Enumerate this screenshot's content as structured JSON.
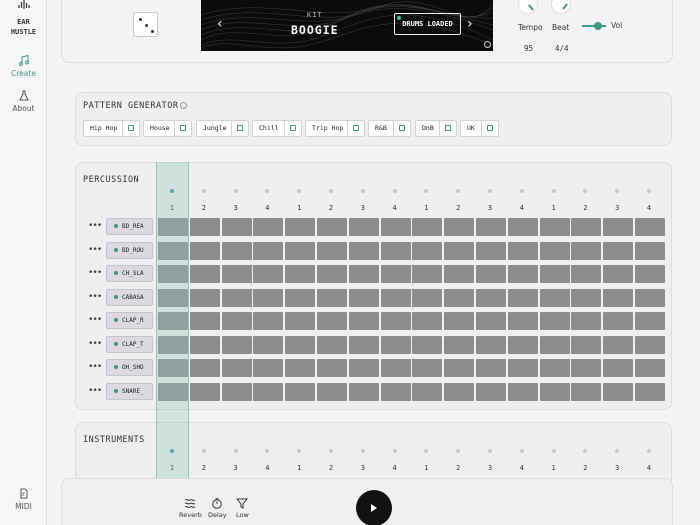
{
  "app": {
    "name_line1": "EAR",
    "name_line2": "HUSTLE"
  },
  "nav": {
    "create": "Create",
    "about": "About",
    "midi": "MIDI"
  },
  "kit": {
    "label": "KIT",
    "name": "BOOGIE",
    "status": "DRUMS LOADED",
    "prev_arrow": "‹",
    "next_arrow": "›"
  },
  "controls": {
    "tempo_label": "Tempo",
    "tempo_value": "95",
    "beat_label": "Beat",
    "beat_value": "4/4",
    "vol_label": "Vol"
  },
  "pattern_generator": {
    "title": "PATTERN GENERATOR",
    "genres": [
      "Hip Hop",
      "House",
      "Jungle",
      "Chill",
      "Trip Hop",
      "R&B",
      "DnB",
      "UK"
    ]
  },
  "percussion": {
    "title": "PERCUSSION",
    "beats": [
      "1",
      "2",
      "3",
      "4",
      "1",
      "2",
      "3",
      "4",
      "1",
      "2",
      "3",
      "4",
      "1",
      "2",
      "3",
      "4"
    ],
    "tracks": [
      "BD_REA",
      "BD_ROU",
      "CH_SLA",
      "CABASA",
      "CLAP_R",
      "CLAP_T",
      "OH_SHO",
      "SNARE_"
    ],
    "track_menu": "•••"
  },
  "instruments": {
    "title": "INSTRUMENTS",
    "beats": [
      "1",
      "2",
      "3",
      "4",
      "1",
      "2",
      "3",
      "4",
      "1",
      "2",
      "3",
      "4",
      "1",
      "2",
      "3",
      "4"
    ]
  },
  "effects": {
    "reverb": "Reverb",
    "delay": "Delay",
    "low": "Low"
  },
  "colors": {
    "accent": "#3d9a82",
    "cell": "#8c8c8f",
    "screen": "#0b0b0b"
  },
  "icons": {
    "logo": "sound-wave-icon",
    "create": "music-note-icon",
    "about": "flask-icon",
    "midi": "midi-file-icon",
    "dice": "dice-icon",
    "reverb": "waves-icon",
    "delay": "timer-icon",
    "low": "filter-icon",
    "play": "play-icon"
  }
}
